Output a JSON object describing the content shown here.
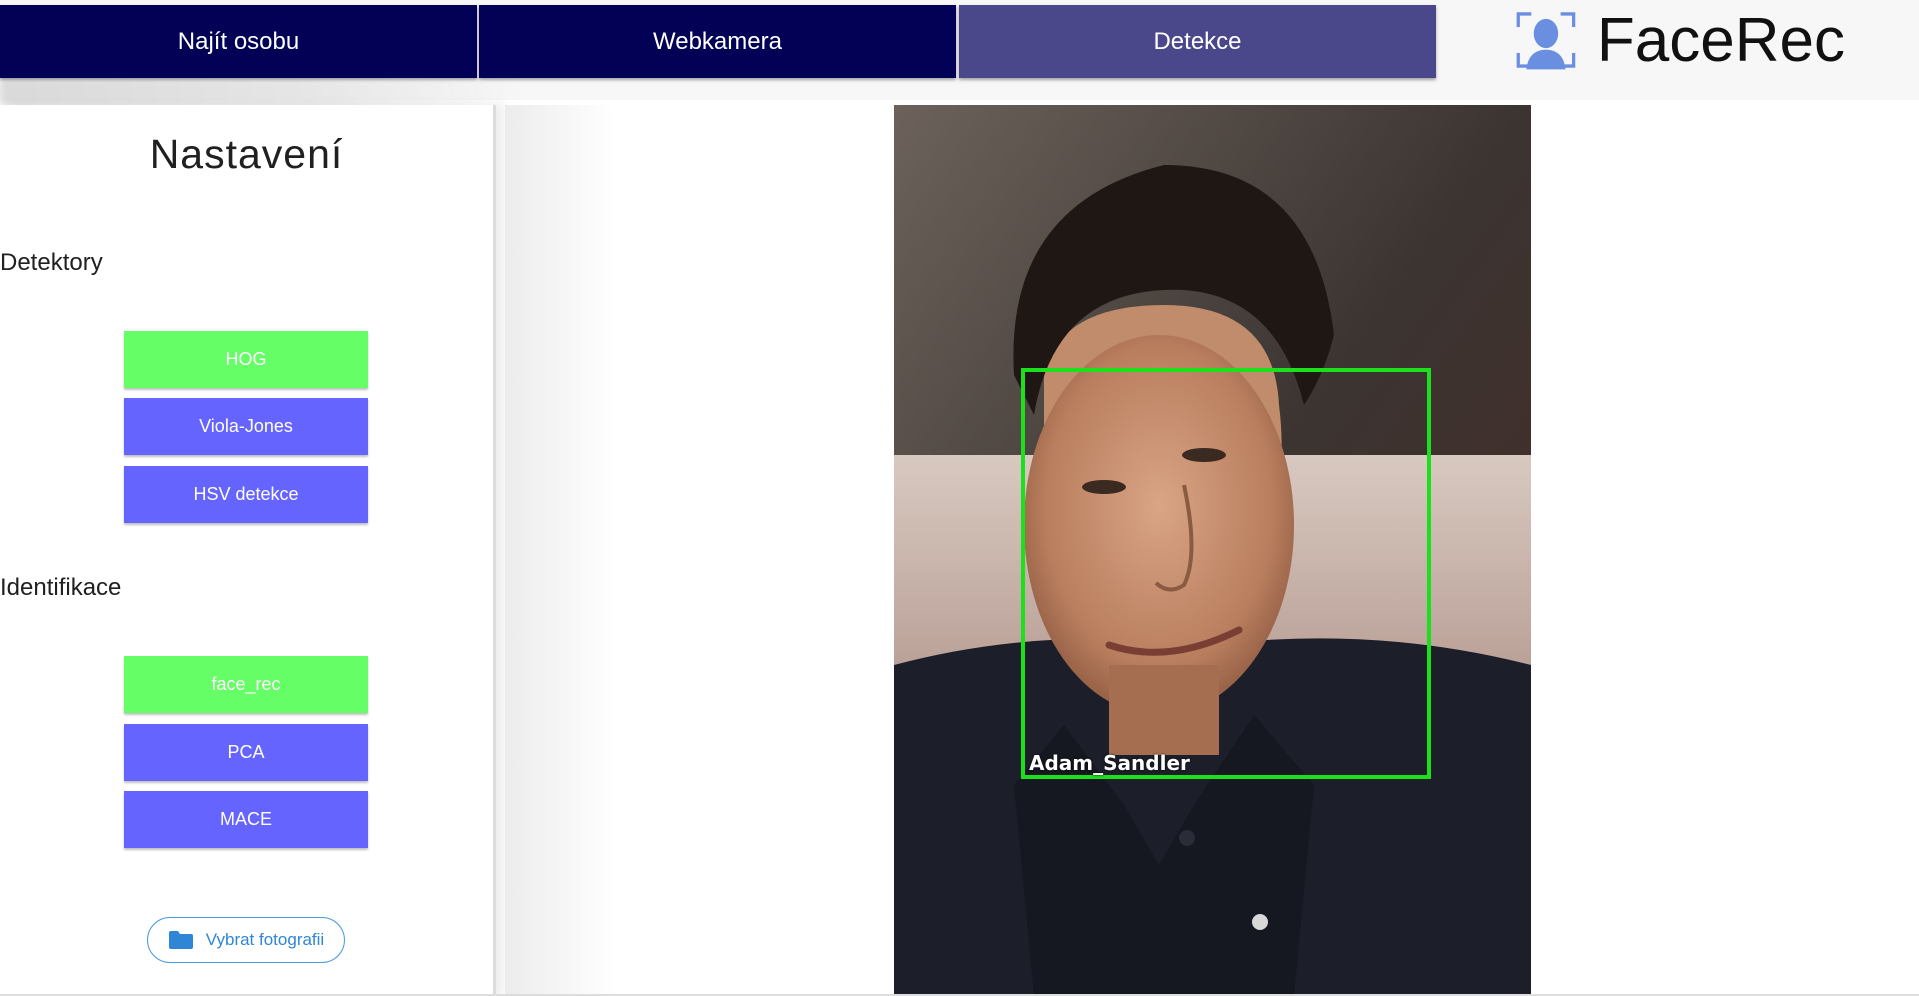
{
  "nav": {
    "tabs": [
      {
        "label": "Najít osobu",
        "active": false
      },
      {
        "label": "Webkamera",
        "active": false
      },
      {
        "label": "Detekce",
        "active": true
      }
    ]
  },
  "logo": {
    "text": "FaceRec",
    "icon": "face-scan-icon"
  },
  "sidebar": {
    "title": "Nastavení",
    "detectors": {
      "heading": "Detektory",
      "options": [
        {
          "label": "HOG",
          "selected": true
        },
        {
          "label": "Viola-Jones",
          "selected": false
        },
        {
          "label": "HSV detekce",
          "selected": false
        }
      ]
    },
    "identification": {
      "heading": "Identifikace",
      "options": [
        {
          "label": "face_rec",
          "selected": true
        },
        {
          "label": "PCA",
          "selected": false
        },
        {
          "label": "MACE",
          "selected": false
        }
      ]
    },
    "file_button": {
      "label": "Vybrat fotografii",
      "icon": "folder-icon"
    }
  },
  "result": {
    "detected_name": "Adam_Sandler"
  },
  "colors": {
    "tab": "#020155",
    "tab_active": "#4a478b",
    "option": "#6664fe",
    "option_selected": "#66fe66",
    "detection_box": "#1be01b",
    "accent_blue": "#2f86d6"
  }
}
